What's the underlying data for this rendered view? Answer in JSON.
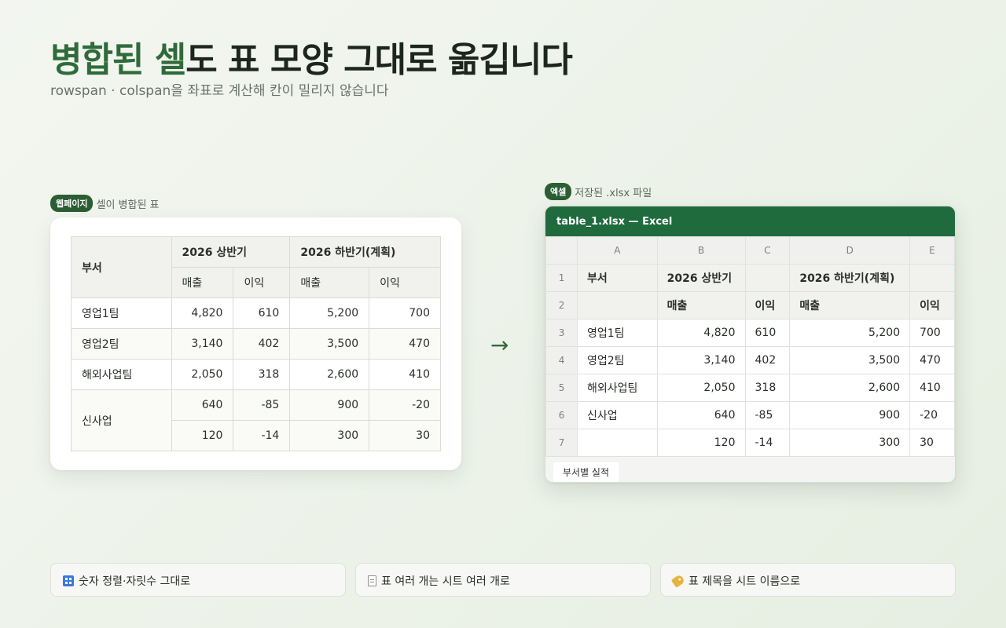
{
  "hero": {
    "title_accent": "병합된 셀",
    "title_rest": "도 표 모양 그대로 옮깁니다",
    "subtitle": "rowspan · colspan을 좌표로 계산해 칸이 밀리지 않습니다"
  },
  "web_caption": {
    "pill": "웹페이지",
    "text": "셀이 병합된 표"
  },
  "excel_caption": {
    "pill": "엑셀",
    "text": "저장된 .xlsx 파일"
  },
  "web_table": {
    "headers": {
      "dept": "부서",
      "h1": "2026 상반기",
      "h2": "2026 하반기(계획)",
      "sales": "매출",
      "profit": "이익"
    },
    "rows": [
      {
        "name": "영업1팀",
        "v": [
          "4,820",
          "610",
          "5,200",
          "700"
        ]
      },
      {
        "name": "영업2팀",
        "v": [
          "3,140",
          "402",
          "3,500",
          "470"
        ]
      },
      {
        "name": "해외사업팀",
        "v": [
          "2,050",
          "318",
          "2,600",
          "410"
        ]
      },
      {
        "name": "신사업",
        "v": [
          "640",
          "-85",
          "900",
          "-20"
        ]
      },
      {
        "name": "",
        "v": [
          "120",
          "-14",
          "300",
          "30"
        ]
      }
    ]
  },
  "arrow": "→",
  "excel": {
    "title": "table_1.xlsx — Excel",
    "columns": [
      "A",
      "B",
      "C",
      "D",
      "E"
    ],
    "rows": [
      {
        "n": "1",
        "c": [
          "부서",
          "2026 상반기",
          "",
          "2026 하반기(계획)",
          ""
        ]
      },
      {
        "n": "2",
        "c": [
          "",
          "매출",
          "이익",
          "매출",
          "이익"
        ]
      },
      {
        "n": "3",
        "c": [
          "영업1팀",
          "4,820",
          "610",
          "5,200",
          "700"
        ]
      },
      {
        "n": "4",
        "c": [
          "영업2팀",
          "3,140",
          "402",
          "3,500",
          "470"
        ]
      },
      {
        "n": "5",
        "c": [
          "해외사업팀",
          "2,050",
          "318",
          "2,600",
          "410"
        ]
      },
      {
        "n": "6",
        "c": [
          "신사업",
          "640",
          "-85",
          "900",
          "-20"
        ]
      },
      {
        "n": "7",
        "c": [
          "",
          "120",
          "-14",
          "300",
          "30"
        ]
      }
    ],
    "sheet_tab": "부서별 실적"
  },
  "features": [
    {
      "icon": "number-grid-icon",
      "text": "숫자 정렬·자릿수 그대로"
    },
    {
      "icon": "page-icon",
      "text": "표 여러 개는 시트 여러 개로"
    },
    {
      "icon": "tag-icon",
      "text": "표 제목을 시트 이름으로"
    }
  ]
}
